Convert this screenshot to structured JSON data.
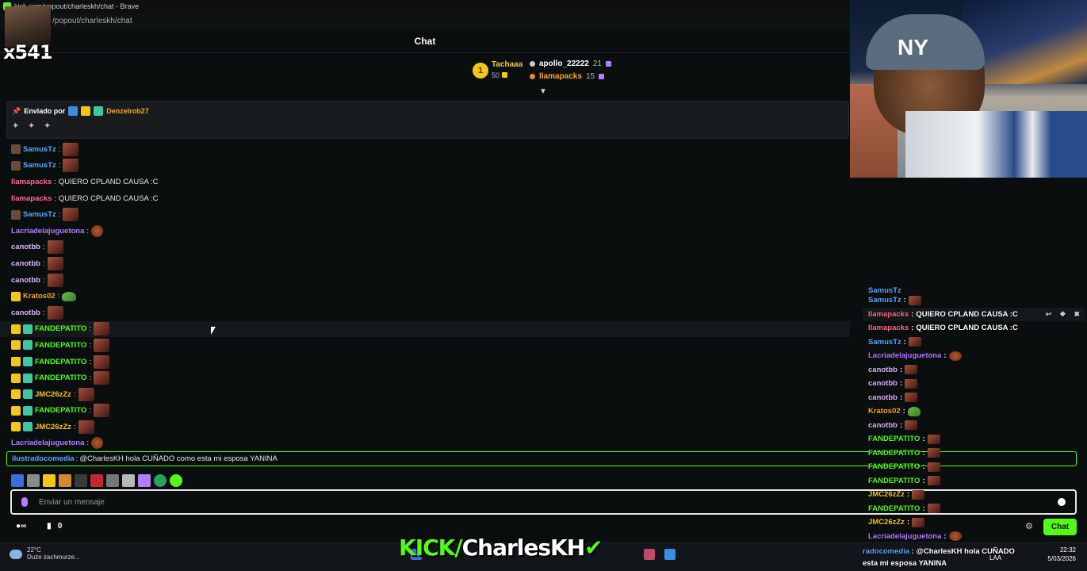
{
  "window": {
    "title": "kick.com/popout/charleskh/chat - Brave",
    "url": "/popout/charleskh/chat"
  },
  "overlay": {
    "viewer_tag": "x541"
  },
  "chat": {
    "header": "Chat",
    "leaderboard": {
      "first": {
        "rank": "1",
        "name": "Tachaaa",
        "points": "50"
      },
      "others": [
        {
          "name": "apollo_22222",
          "points": "21"
        },
        {
          "name": "llamapacks",
          "points": "15"
        }
      ]
    },
    "pinned": {
      "label": "Enviado por",
      "user": "Denzelrob27"
    },
    "messages": [
      {
        "user": "SamusTz",
        "color": "#5aa7ff",
        "text": "",
        "badges": [
          "ghost"
        ],
        "emote": "block"
      },
      {
        "user": "SamusTz",
        "color": "#5aa7ff",
        "text": "",
        "badges": [
          "ghost"
        ],
        "emote": "block"
      },
      {
        "user": "llamapacks",
        "color": "#ff6b8a",
        "text": "QUIERO CPLAND CAUSA :C",
        "badges": [],
        "emote": ""
      },
      {
        "user": "llamapacks",
        "color": "#ff6b8a",
        "text": "QUIERO CPLAND CAUSA :C",
        "badges": [],
        "emote": ""
      },
      {
        "user": "SamusTz",
        "color": "#5aa7ff",
        "text": "",
        "badges": [
          "ghost"
        ],
        "emote": "block"
      },
      {
        "user": "Lacriadelajuguetona",
        "color": "#b57cff",
        "text": "",
        "badges": [],
        "emote": "round"
      },
      {
        "user": "canotbb",
        "color": "#d9b3ff",
        "text": "",
        "badges": [],
        "emote": "block"
      },
      {
        "user": "canotbb",
        "color": "#d9b3ff",
        "text": "",
        "badges": [],
        "emote": "block"
      },
      {
        "user": "canotbb",
        "color": "#d9b3ff",
        "text": "",
        "badges": [],
        "emote": "block"
      },
      {
        "user": "Kratos02",
        "color": "#f5a623",
        "text": "",
        "badges": [
          "crown"
        ],
        "emote": "turtle"
      },
      {
        "user": "canotbb",
        "color": "#d9b3ff",
        "text": "",
        "badges": [],
        "emote": "block"
      },
      {
        "user": "FANDEPATITO",
        "color": "#53fc18",
        "text": "",
        "badges": [
          "crown",
          "sub"
        ],
        "emote": "block"
      },
      {
        "user": "FANDEPATITO",
        "color": "#53fc18",
        "text": "",
        "badges": [
          "crown",
          "sub"
        ],
        "emote": "block"
      },
      {
        "user": "FANDEPATITO",
        "color": "#53fc18",
        "text": "",
        "badges": [
          "crown",
          "sub"
        ],
        "emote": "block"
      },
      {
        "user": "FANDEPATITO",
        "color": "#53fc18",
        "text": "",
        "badges": [
          "crown",
          "sub"
        ],
        "emote": "block"
      },
      {
        "user": "JMC26zZz",
        "color": "#f5c518",
        "text": "",
        "badges": [
          "crown",
          "sub"
        ],
        "emote": "block"
      },
      {
        "user": "FANDEPATITO",
        "color": "#53fc18",
        "text": "",
        "badges": [
          "crown",
          "sub"
        ],
        "emote": "block"
      },
      {
        "user": "JMC26zZz",
        "color": "#f5c518",
        "text": "",
        "badges": [
          "crown",
          "sub"
        ],
        "emote": "block"
      },
      {
        "user": "Lacriadelajuguetona",
        "color": "#b57cff",
        "text": "",
        "badges": [],
        "emote": "round"
      }
    ],
    "reply": {
      "user": "ilustradocomedia",
      "text": "@CharlesKH hola CUÑADO como esta mi esposa YANINA"
    },
    "input_placeholder": "Enviar un mensaje",
    "points": "0",
    "chat_button": "Chat"
  },
  "overlay_chat": {
    "top_partial": "SamusTz",
    "rows": [
      {
        "user": "SamusTz",
        "color": "#5aa7ff",
        "text": "",
        "emote": "block"
      },
      {
        "user": "llamapacks",
        "color": "#ff6b8a",
        "text": "QUIERO CPLAND CAUSA :C",
        "emote": ""
      },
      {
        "user": "llamapacks",
        "color": "#ff6b8a",
        "text": "QUIERO CPLAND CAUSA :C",
        "emote": ""
      },
      {
        "user": "SamusTz",
        "color": "#5aa7ff",
        "text": "",
        "emote": "block"
      },
      {
        "user": "Lacriadelajuguetona",
        "color": "#b57cff",
        "text": "",
        "emote": "round"
      },
      {
        "user": "canotbb",
        "color": "#d9b3ff",
        "text": "",
        "emote": "block"
      },
      {
        "user": "canotbb",
        "color": "#d9b3ff",
        "text": "",
        "emote": "block"
      },
      {
        "user": "canotbb",
        "color": "#d9b3ff",
        "text": "",
        "emote": "block"
      },
      {
        "user": "Kratos02",
        "color": "#f5a623",
        "text": "",
        "emote": "turtle"
      },
      {
        "user": "canotbb",
        "color": "#d9b3ff",
        "text": "",
        "emote": "block"
      },
      {
        "user": "FANDEPATITO",
        "color": "#53fc18",
        "text": "",
        "emote": "block"
      },
      {
        "user": "FANDEPATITO",
        "color": "#53fc18",
        "text": "",
        "emote": "block"
      },
      {
        "user": "FANDEPATITO",
        "color": "#53fc18",
        "text": "",
        "emote": "block"
      },
      {
        "user": "FANDEPATITO",
        "color": "#53fc18",
        "text": "",
        "emote": "block"
      },
      {
        "user": "JMC26zZz",
        "color": "#f5c518",
        "text": "",
        "emote": "block"
      },
      {
        "user": "FANDEPATITO",
        "color": "#53fc18",
        "text": "",
        "emote": "block"
      },
      {
        "user": "JMC26zZz",
        "color": "#f5c518",
        "text": "",
        "emote": "block"
      },
      {
        "user": "Lacriadelajuguetona",
        "color": "#b57cff",
        "text": "",
        "emote": "round"
      }
    ],
    "bottom_line1_user": "radocomedia",
    "bottom_line1_text": "@CharlesKH hola CUÑADO",
    "bottom_line2": "esta mi esposa YANINA"
  },
  "stream_overlay": {
    "kick": "KICK/",
    "channel": "CharlesKH"
  },
  "taskbar": {
    "weather_temp": "22°C",
    "weather_desc": "Duże zachmurze...",
    "lang": "LAA",
    "time": "22:32",
    "date": "5/03/2026"
  },
  "colors": {
    "accent": "#53fc18",
    "background": "#0b0e0f"
  }
}
